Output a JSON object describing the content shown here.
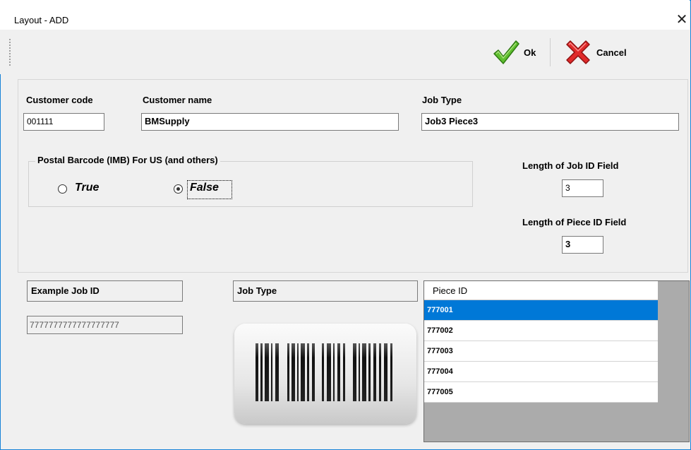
{
  "window": {
    "title": "Layout - ADD",
    "close_glyph": "✕"
  },
  "toolbar": {
    "ok_label": "Ok",
    "ok_icon": "checkmark-icon",
    "ok_color": "#4caf2a",
    "cancel_label": "Cancel",
    "cancel_icon": "red-x-icon",
    "cancel_color": "#d8232a"
  },
  "form": {
    "customer_code_label": "Customer code",
    "customer_code_value": "001111",
    "customer_name_label": "Customer name",
    "customer_name_value": "BMSupply",
    "job_type_label": "Job Type",
    "job_type_value": "Job3 Piece3",
    "postal_group_label": "Postal Barcode  (IMB) For US (and others)",
    "radio_true_label": "True",
    "radio_false_label": "False",
    "selected_radio": "False",
    "job_id_len_label": "Length of Job ID Field",
    "job_id_len_value": "3",
    "piece_id_len_label": "Length of Piece ID Field",
    "piece_id_len_value": "3"
  },
  "bottom": {
    "example_job_id_label": "Example Job ID",
    "example_job_id_value": "7777777777777777777",
    "job_type_header": "Job Type",
    "barcode_icon": "barcode-icon"
  },
  "grid": {
    "column_header": "Piece ID",
    "rows": [
      "777001",
      "777002",
      "777003",
      "777004",
      "777005"
    ],
    "selected_index": 0,
    "selection_color": "#0078d7"
  }
}
